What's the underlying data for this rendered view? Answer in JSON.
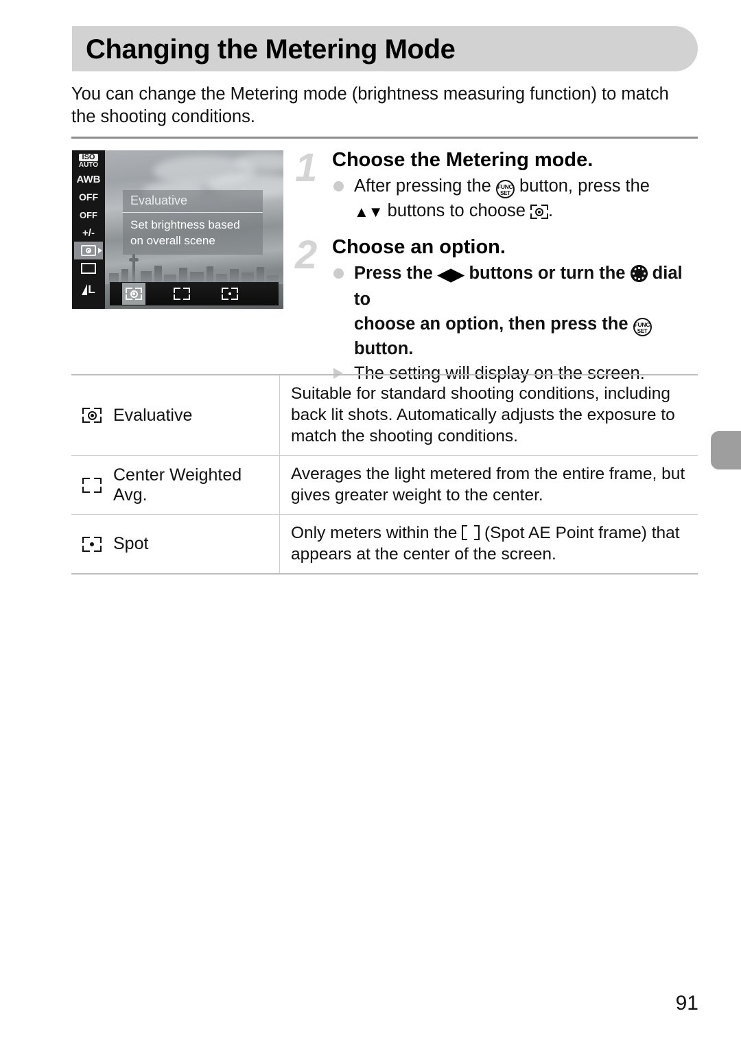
{
  "page": {
    "title": "Changing the Metering Mode",
    "intro": "You can change the Metering mode (brightness measuring function) to match the shooting conditions.",
    "page_number": "91"
  },
  "illustration": {
    "name": "camera-lcd-screen",
    "rail_icons": [
      {
        "name": "iso-auto-icon",
        "top": "ISO",
        "bottom": "AUTO"
      },
      {
        "name": "white-balance-icon",
        "label": "AWB"
      },
      {
        "name": "my-colors-off-icon",
        "label": "OFF"
      },
      {
        "name": "bracketing-off-icon",
        "label": "OFF"
      },
      {
        "name": "flash-exposure-compensation-icon",
        "label": "+/-"
      },
      {
        "name": "metering-mode-icon",
        "label": ""
      },
      {
        "name": "aspect-ratio-icon",
        "label": ""
      },
      {
        "name": "image-quality-icon",
        "label": "L"
      }
    ],
    "menu_panel": {
      "title": "Evaluative",
      "description_line1": "Set brightness based",
      "description_line2": "on overall scene"
    },
    "option_strip": [
      {
        "name": "strip-option-evaluative",
        "selected": true
      },
      {
        "name": "strip-option-center-weighted",
        "selected": false
      },
      {
        "name": "strip-option-spot",
        "selected": false
      }
    ]
  },
  "steps": [
    {
      "number": "1",
      "heading": "Choose the Metering mode.",
      "lines": [
        {
          "marker": "dot",
          "prefix": "After pressing the ",
          "mid": " button, press the",
          "suffix": ""
        },
        {
          "marker": "none",
          "prefix": "",
          "mid": " buttons to choose ",
          "suffix": "."
        }
      ]
    },
    {
      "number": "2",
      "heading": "Choose an option.",
      "lines": [
        {
          "marker": "dot",
          "prefix": "Press the ",
          "mid": " buttons or turn the ",
          "suffix": " dial to"
        },
        {
          "marker": "none",
          "prefix": "choose an option, then press the ",
          "mid": "",
          "suffix": ""
        },
        {
          "marker": "none",
          "prefix": "button.",
          "mid": "",
          "suffix": ""
        },
        {
          "marker": "tri",
          "prefix": "The setting will display on the screen.",
          "mid": "",
          "suffix": ""
        }
      ]
    }
  ],
  "table": {
    "rows": [
      {
        "icon": "evaluative-metering-icon",
        "label": "Evaluative",
        "description": "Suitable for standard shooting conditions, including back lit shots. Automatically adjusts the exposure to match the shooting conditions."
      },
      {
        "icon": "center-weighted-metering-icon",
        "label": "Center Weighted Avg.",
        "description": "Averages the light metered from the entire frame, but gives greater weight to the center."
      },
      {
        "icon": "spot-metering-icon",
        "label": "Spot",
        "desc_before": "Only meters within the ",
        "desc_after": " (Spot AE Point frame) that appears at the center of the screen."
      }
    ]
  },
  "colors": {
    "header_bar": "#d2d2d2",
    "step_number": "#d4d4d4",
    "rule": "#8d8d8d",
    "edge_tab": "#9e9e9e",
    "table_border": "#cfcfcf"
  }
}
